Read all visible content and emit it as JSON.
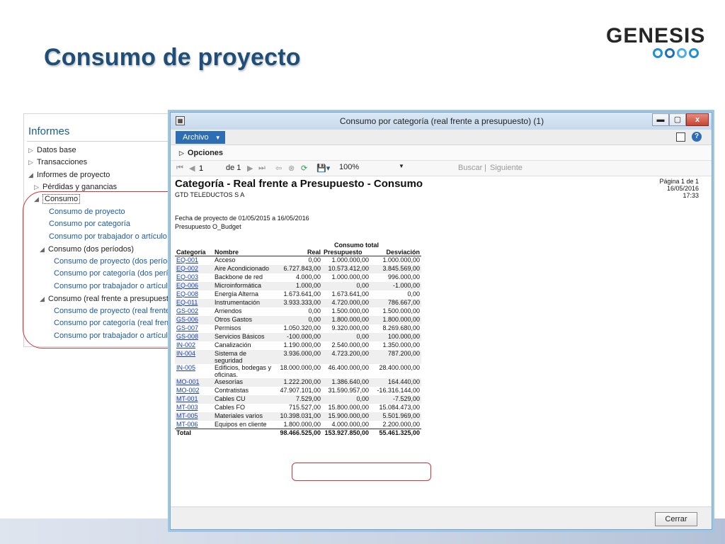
{
  "slide": {
    "title": "Consumo de proyecto",
    "logo_text": "GENESIS"
  },
  "nav": {
    "title": "Informes",
    "items": [
      {
        "label": "Datos base"
      },
      {
        "label": "Transacciones"
      },
      {
        "label": "Informes de proyecto"
      },
      {
        "label": "Pérdidas y ganancias"
      },
      {
        "label": "Consumo"
      },
      {
        "label": "Consumo de proyecto"
      },
      {
        "label": "Consumo por categoría"
      },
      {
        "label": "Consumo por trabajador o artículo"
      },
      {
        "label": "Consumo (dos períodos)"
      },
      {
        "label": "Consumo de proyecto (dos períodos"
      },
      {
        "label": "Consumo por categoría (dos períod"
      },
      {
        "label": "Consumo por trabajador o artículo ("
      },
      {
        "label": "Consumo (real frente a presupuesto)"
      },
      {
        "label": "Consumo de proyecto (real frente a p"
      },
      {
        "label": "Consumo por categoría (real frente a"
      },
      {
        "label": "Consumo por trabajador o artículo (r"
      }
    ]
  },
  "window": {
    "title": "Consumo por categoría (real frente a presupuesto) (1)",
    "minimize_glyph": "▬",
    "maximize_glyph": "▢",
    "close_glyph": "x",
    "archivo_label": "Archivo",
    "help_glyph": "?",
    "options_label": "Opciones"
  },
  "toolbar": {
    "page_value": "1",
    "page_of_label": "de 1",
    "zoom_value": "100%",
    "find_label": "Buscar",
    "next_label": "Siguiente"
  },
  "report": {
    "title": "Categoría - Real frente a Presupuesto - Consumo",
    "company": "GTD TELEDUCTOS S A",
    "page_info": "Página 1 de 1",
    "date": "16/05/2016",
    "time": "17:33",
    "project_dates": "Fecha de proyecto de 01/05/2015 a 16/05/2016",
    "budget": "Presupuesto O_Budget",
    "columns": {
      "group": "Consumo total",
      "categoria": "Categoría",
      "nombre": "Nombre",
      "real": "Real",
      "presupuesto": "Presupuesto",
      "desviacion": "Desviación"
    },
    "rows": [
      {
        "cat": "EQ-001",
        "name": "Acceso",
        "real": "0,00",
        "budget": "1.000.000,00",
        "dev": "1.000.000,00"
      },
      {
        "cat": "EQ-002",
        "name": "Aire Acondicionado",
        "real": "6.727.843,00",
        "budget": "10.573.412,00",
        "dev": "3.845.569,00"
      },
      {
        "cat": "EQ-003",
        "name": "Backbone de red",
        "real": "4.000,00",
        "budget": "1.000.000,00",
        "dev": "996.000,00"
      },
      {
        "cat": "EQ-006",
        "name": "Microinformática",
        "real": "1.000,00",
        "budget": "0,00",
        "dev": "-1.000,00"
      },
      {
        "cat": "EQ-008",
        "name": "Energía Alterna",
        "real": "1.673.641,00",
        "budget": "1.673.641,00",
        "dev": "0,00"
      },
      {
        "cat": "EQ-011",
        "name": "Instrumentación",
        "real": "3.933.333,00",
        "budget": "4.720.000,00",
        "dev": "786.667,00"
      },
      {
        "cat": "GS-002",
        "name": "Arriendos",
        "real": "0,00",
        "budget": "1.500.000,00",
        "dev": "1.500.000,00"
      },
      {
        "cat": "GS-006",
        "name": "Otros Gastos",
        "real": "0,00",
        "budget": "1.800.000,00",
        "dev": "1.800.000,00"
      },
      {
        "cat": "GS-007",
        "name": "Permisos",
        "real": "1.050.320,00",
        "budget": "9.320.000,00",
        "dev": "8.269.680,00"
      },
      {
        "cat": "GS-008",
        "name": "Servicios Básicos",
        "real": "-100.000,00",
        "budget": "0,00",
        "dev": "100.000,00"
      },
      {
        "cat": "IN-002",
        "name": "Canalización",
        "real": "1.190.000,00",
        "budget": "2.540.000,00",
        "dev": "1.350.000,00"
      },
      {
        "cat": "IN-004",
        "name": "Sistema de seguridad",
        "real": "3.936.000,00",
        "budget": "4.723.200,00",
        "dev": "787.200,00"
      },
      {
        "cat": "IN-005",
        "name": "Edificios, bodegas y oficinas.",
        "real": "18.000.000,00",
        "budget": "46.400.000,00",
        "dev": "28.400.000,00"
      },
      {
        "cat": "MO-001",
        "name": "Asesorías",
        "real": "1.222.200,00",
        "budget": "1.386.640,00",
        "dev": "164.440,00"
      },
      {
        "cat": "MO-002",
        "name": "Contratistas",
        "real": "47.907.101,00",
        "budget": "31.590.957,00",
        "dev": "-16.316.144,00"
      },
      {
        "cat": "MT-001",
        "name": "Cables CU",
        "real": "7.529,00",
        "budget": "0,00",
        "dev": "-7.529,00"
      },
      {
        "cat": "MT-003",
        "name": "Cables FO",
        "real": "715.527,00",
        "budget": "15.800.000,00",
        "dev": "15.084.473,00"
      },
      {
        "cat": "MT-005",
        "name": "Materiales varios",
        "real": "10.398.031,00",
        "budget": "15.900.000,00",
        "dev": "5.501.969,00"
      },
      {
        "cat": "MT-006",
        "name": "Equipos en cliente",
        "real": "1.800.000,00",
        "budget": "4.000.000,00",
        "dev": "2.200.000,00"
      }
    ],
    "total": {
      "label": "Total",
      "real": "98.466.525,00",
      "budget": "153.927.850,00",
      "dev": "55.461.325,00"
    }
  },
  "footer": {
    "close_label": "Cerrar"
  },
  "colors": {
    "title_blue": "#1f4e79",
    "window_accent": "#2d6db5",
    "annotation_red": "#d2343a",
    "link_blue": "#1c43b0"
  }
}
